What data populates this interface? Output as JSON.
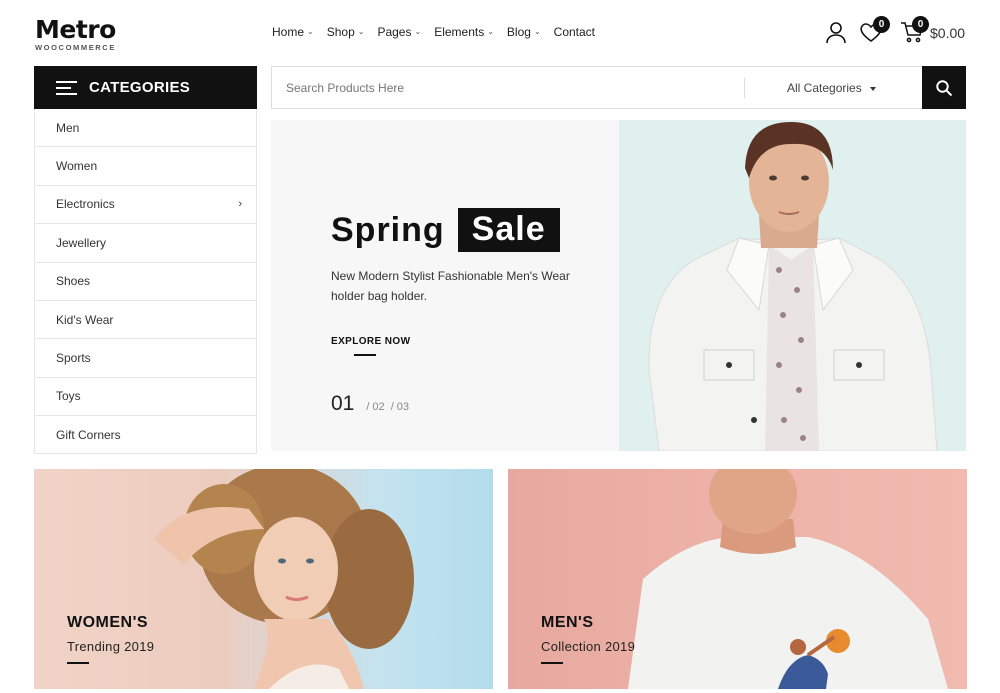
{
  "header": {
    "logo": {
      "word": "Metro",
      "sub": "WOOCOMMERCE"
    },
    "nav": [
      {
        "label": "Home",
        "has_dropdown": true
      },
      {
        "label": "Shop",
        "has_dropdown": true
      },
      {
        "label": "Pages",
        "has_dropdown": true
      },
      {
        "label": "Elements",
        "has_dropdown": true
      },
      {
        "label": "Blog",
        "has_dropdown": true
      },
      {
        "label": "Contact",
        "has_dropdown": false
      }
    ],
    "wishlist_count": "0",
    "cart_count": "0",
    "cart_total": "$0.00"
  },
  "categories": {
    "title": "CATEGORIES",
    "items": [
      {
        "label": "Men"
      },
      {
        "label": "Women"
      },
      {
        "label": "Electronics",
        "has_submenu": true
      },
      {
        "label": "Jewellery"
      },
      {
        "label": "Shoes"
      },
      {
        "label": "Kid's Wear"
      },
      {
        "label": "Sports"
      },
      {
        "label": "Toys"
      },
      {
        "label": "Gift Corners"
      }
    ]
  },
  "search": {
    "placeholder": "Search Products Here",
    "category_selected": "All Categories"
  },
  "hero": {
    "title_plain": "Spring",
    "title_highlight": "Sale",
    "description": "New Modern Stylist Fashionable Men's Wear holder bag holder.",
    "cta": "EXPLORE NOW",
    "slide_current": "01",
    "slide_others": [
      "02",
      "03"
    ],
    "bg_color": "#f7f7f7",
    "image_bg_color": "#dff0ef"
  },
  "banners": [
    {
      "title": "WOMEN'S",
      "subtitle": "Trending 2019"
    },
    {
      "title": "MEN'S",
      "subtitle": "Collection 2019"
    }
  ],
  "icons": [
    "menu-icon",
    "user-icon",
    "heart-icon",
    "cart-icon",
    "search-icon",
    "chevron-down-icon",
    "chevron-right-icon"
  ]
}
